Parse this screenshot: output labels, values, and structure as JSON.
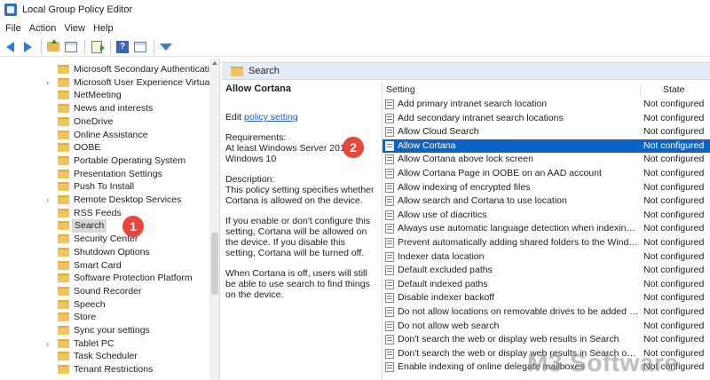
{
  "window": {
    "title": "Local Group Policy Editor"
  },
  "menubar": [
    "File",
    "Action",
    "View",
    "Help"
  ],
  "toolbar": {
    "help_glyph": "?"
  },
  "tree": {
    "items": [
      {
        "label": "Microsoft Secondary Authenticatio",
        "expandable": false
      },
      {
        "label": "Microsoft User Experience Virtualiz",
        "expandable": true
      },
      {
        "label": "NetMeeting",
        "expandable": false
      },
      {
        "label": "News and interests",
        "expandable": false
      },
      {
        "label": "OneDrive",
        "expandable": false
      },
      {
        "label": "Online Assistance",
        "expandable": false
      },
      {
        "label": "OOBE",
        "expandable": false
      },
      {
        "label": "Portable Operating System",
        "expandable": false
      },
      {
        "label": "Presentation Settings",
        "expandable": false
      },
      {
        "label": "Push To Install",
        "expandable": false
      },
      {
        "label": "Remote Desktop Services",
        "expandable": true
      },
      {
        "label": "RSS Feeds",
        "expandable": false
      },
      {
        "label": "Search",
        "expandable": false,
        "selected": true
      },
      {
        "label": "Security Center",
        "expandable": false
      },
      {
        "label": "Shutdown Options",
        "expandable": false
      },
      {
        "label": "Smart Card",
        "expandable": false
      },
      {
        "label": "Software Protection Platform",
        "expandable": false
      },
      {
        "label": "Sound Recorder",
        "expandable": false
      },
      {
        "label": "Speech",
        "expandable": false
      },
      {
        "label": "Store",
        "expandable": false
      },
      {
        "label": "Sync your settings",
        "expandable": false
      },
      {
        "label": "Tablet PC",
        "expandable": true
      },
      {
        "label": "Task Scheduler",
        "expandable": false
      },
      {
        "label": "Tenant Restrictions",
        "expandable": false
      }
    ]
  },
  "right_panel": {
    "header": "Search"
  },
  "description": {
    "heading": "Allow Cortana",
    "edit_prefix": "Edit ",
    "edit_link": "policy setting",
    "requirements_label": "Requirements:",
    "requirements_text": "At least Windows Server 2016, Windows 10",
    "description_label": "Description:",
    "description_text": "This policy setting specifies whether Cortana is allowed on the device.",
    "paragraph2": "If you enable or don't configure this setting, Cortana will be allowed on the device. If you disable this setting, Cortana will be turned off.",
    "paragraph3": "When Cortana is off, users will still be able to use search to find things on the device."
  },
  "list": {
    "columns": {
      "setting": "Setting",
      "state": "State"
    },
    "rows": [
      {
        "name": "Add primary intranet search location",
        "state": "Not configured"
      },
      {
        "name": "Add secondary intranet search locations",
        "state": "Not configured"
      },
      {
        "name": "Allow Cloud Search",
        "state": "Not configured"
      },
      {
        "name": "Allow Cortana",
        "state": "Not configured",
        "selected": true
      },
      {
        "name": "Allow Cortana above lock screen",
        "state": "Not configured"
      },
      {
        "name": "Allow Cortana Page in OOBE on an AAD account",
        "state": "Not configured"
      },
      {
        "name": "Allow indexing of encrypted files",
        "state": "Not configured"
      },
      {
        "name": "Allow search and Cortana to use location",
        "state": "Not configured"
      },
      {
        "name": "Allow use of diacritics",
        "state": "Not configured"
      },
      {
        "name": "Always use automatic language detection when indexing co...",
        "state": "Not configured"
      },
      {
        "name": "Prevent automatically adding shared folders to the Window...",
        "state": "Not configured"
      },
      {
        "name": "Indexer data location",
        "state": "Not configured"
      },
      {
        "name": "Default excluded paths",
        "state": "Not configured"
      },
      {
        "name": "Default indexed paths",
        "state": "Not configured"
      },
      {
        "name": "Disable indexer backoff",
        "state": "Not configured"
      },
      {
        "name": "Do not allow locations on removable drives to be added to li...",
        "state": "Not configured"
      },
      {
        "name": "Do not allow web search",
        "state": "Not configured"
      },
      {
        "name": "Don't search the web or display web results in Search",
        "state": "Not configured"
      },
      {
        "name": "Don't search the web or display web results in Search over...",
        "state": "Not configured"
      },
      {
        "name": "Enable indexing of online delegate mailboxes",
        "state": "Not configured"
      }
    ]
  },
  "callouts": [
    "1",
    "2"
  ],
  "watermark": "M3 Software"
}
